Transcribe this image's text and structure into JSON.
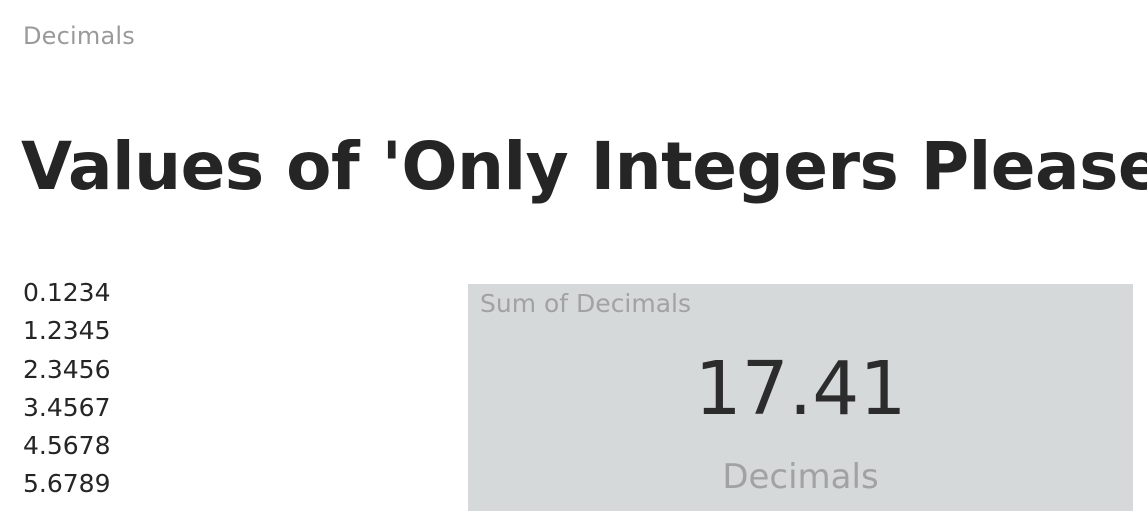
{
  "table": {
    "header": "Decimals",
    "values": [
      "0.1234",
      "1.2345",
      "2.3456",
      "3.4567",
      "4.5678",
      "5.6789"
    ]
  },
  "title": "Values of 'Only Integers Please'",
  "card": {
    "title": "Sum of Decimals",
    "value": "17.41",
    "label": "Decimals"
  }
}
